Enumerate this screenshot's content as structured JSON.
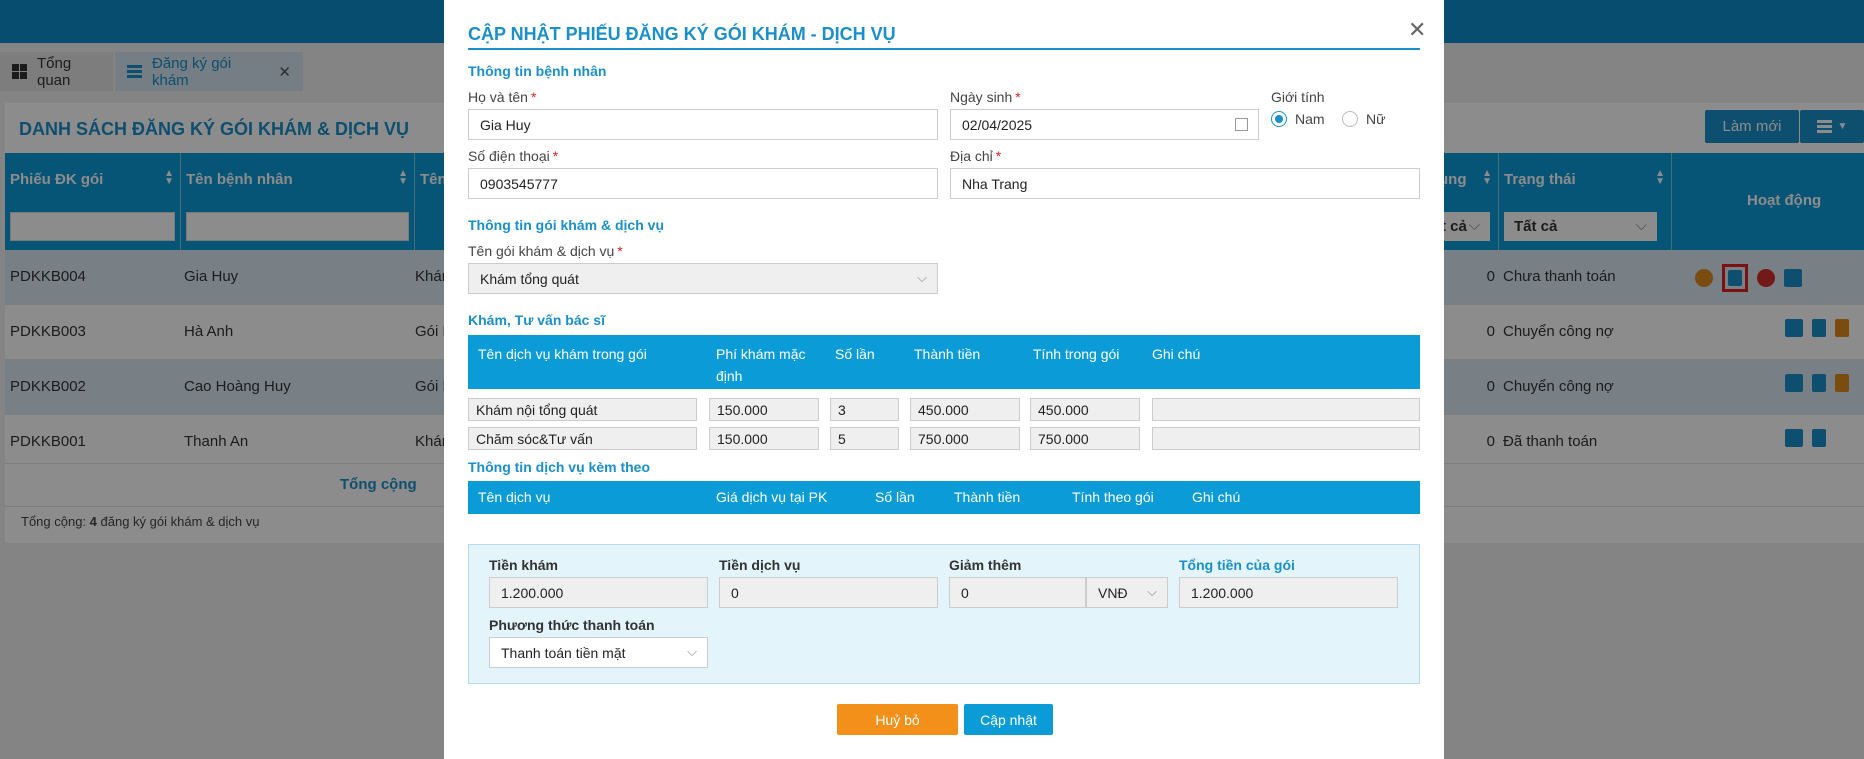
{
  "app": {
    "tabs": [
      {
        "label": "Tổng quan",
        "icon": "dashboard-icon"
      },
      {
        "label": "Đăng ký gói khám",
        "icon": "list-icon"
      }
    ],
    "panel_title": "DANH SÁCH ĐĂNG KÝ GÓI KHÁM & DỊCH VỤ",
    "new_button": "Làm mới",
    "columns": [
      "Phiếu ĐK gói",
      "Tên bệnh nhân",
      "Tên",
      "ụng",
      "Trạng thái",
      "Hoạt động"
    ],
    "filter_partial": "t cả",
    "filter_status": "Tất cả",
    "rows": [
      {
        "code": "PDKKB004",
        "name": "Gia Huy",
        "pkg": "Khár",
        "count": "0",
        "status": "Chưa thanh toán"
      },
      {
        "code": "PDKKB003",
        "name": "Hà Anh",
        "pkg": "Gói K",
        "count": "0",
        "status": "Chuyển công nợ"
      },
      {
        "code": "PDKKB002",
        "name": "Cao Hoàng Huy",
        "pkg": "Gói K",
        "count": "0",
        "status": "Chuyển công nợ"
      },
      {
        "code": "PDKKB001",
        "name": "Thanh An",
        "pkg": "Khár",
        "count": "0",
        "status": "Đã thanh toán"
      }
    ],
    "total_label": "Tổng cộng",
    "footer_prefix": "Tổng cộng: ",
    "footer_count": "4",
    "footer_suffix": " đăng ký gói khám & dịch vụ"
  },
  "modal": {
    "title": "CẬP NHẬT PHIẾU ĐĂNG KÝ GÓI KHÁM - DỊCH VỤ",
    "patient_section": "Thông tin bệnh nhân",
    "name_label": "Họ và tên",
    "name_value": "Gia Huy",
    "dob_label": "Ngày sinh",
    "dob_value": "02/04/2025",
    "gender_label": "Giới tính",
    "gender_male": "Nam",
    "gender_female": "Nữ",
    "phone_label": "Số điện thoại",
    "phone_value": "0903545777",
    "address_label": "Địa chỉ",
    "address_value": "Nha Trang",
    "package_section": "Thông tin gói khám & dịch vụ",
    "package_label": "Tên gói khám & dịch vụ",
    "package_value": "Khám tổng quát",
    "exam_section": "Khám, Tư vấn bác sĩ",
    "exam_headers": [
      "Tên dịch vụ khám trong gói",
      "Phí khám mặc định",
      "Số lần",
      "Thành tiền",
      "Tính trong gói",
      "Ghi chú"
    ],
    "exam_rows": [
      {
        "name": "Khám nội tổng quát",
        "fee": "150.000",
        "times": "3",
        "amount": "450.000",
        "in_pkg": "450.000",
        "note": ""
      },
      {
        "name": "Chăm sóc&Tư vấn",
        "fee": "150.000",
        "times": "5",
        "amount": "750.000",
        "in_pkg": "750.000",
        "note": ""
      }
    ],
    "service_section": "Thông tin dịch vụ kèm theo",
    "service_headers": [
      "Tên dịch vụ",
      "Giá dịch vụ tại PK",
      "Số lần",
      "Thành tiền",
      "Tính theo gói",
      "Ghi chú"
    ],
    "summary": {
      "exam_fee_label": "Tiền khám",
      "exam_fee_value": "1.200.000",
      "service_fee_label": "Tiền dịch vụ",
      "service_fee_value": "0",
      "discount_label": "Giảm thêm",
      "discount_value": "0",
      "discount_unit": "VNĐ",
      "total_label": "Tổng tiền của gói",
      "total_value": "1.200.000",
      "payment_label": "Phương thức thanh toán",
      "payment_value": "Thanh toán tiền mặt"
    },
    "cancel_button": "Huỷ bỏ",
    "update_button": "Cập nhật"
  },
  "colors": {
    "accent": "#0b9cd8",
    "title_blue": "#1a8fc9",
    "cancel_orange": "#f29019",
    "required_red": "#e02020"
  }
}
